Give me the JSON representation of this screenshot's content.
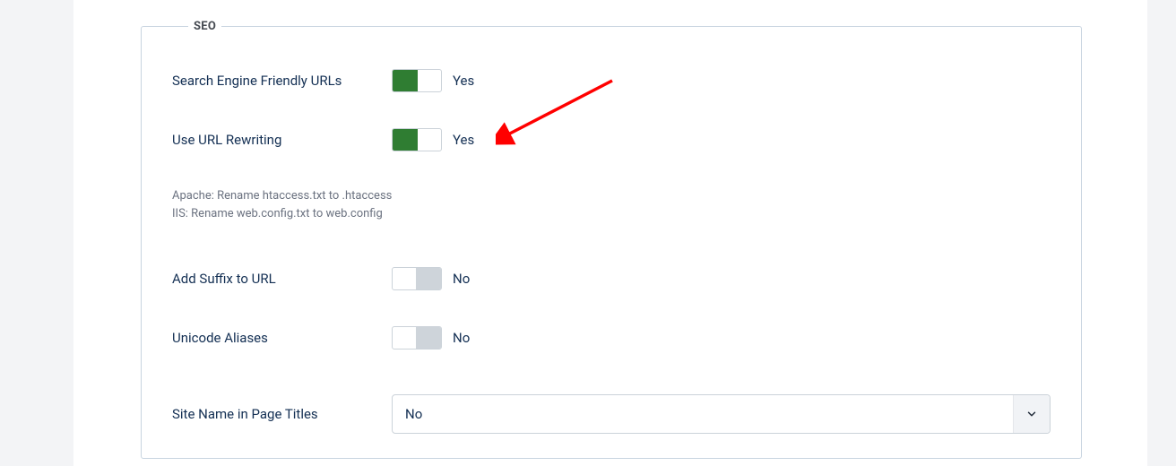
{
  "section_title": "SEO",
  "rows": {
    "sef_urls": {
      "label": "Search Engine Friendly URLs",
      "state_text": "Yes"
    },
    "rewrite": {
      "label": "Use URL Rewriting",
      "state_text": "Yes"
    },
    "suffix": {
      "label": "Add Suffix to URL",
      "state_text": "No"
    },
    "unicode": {
      "label": "Unicode Aliases",
      "state_text": "No"
    },
    "sitename": {
      "label": "Site Name in Page Titles",
      "value": "No"
    }
  },
  "help": {
    "line1": "Apache: Rename htaccess.txt to .htaccess",
    "line2": "IIS: Rename web.config.txt to web.config"
  }
}
